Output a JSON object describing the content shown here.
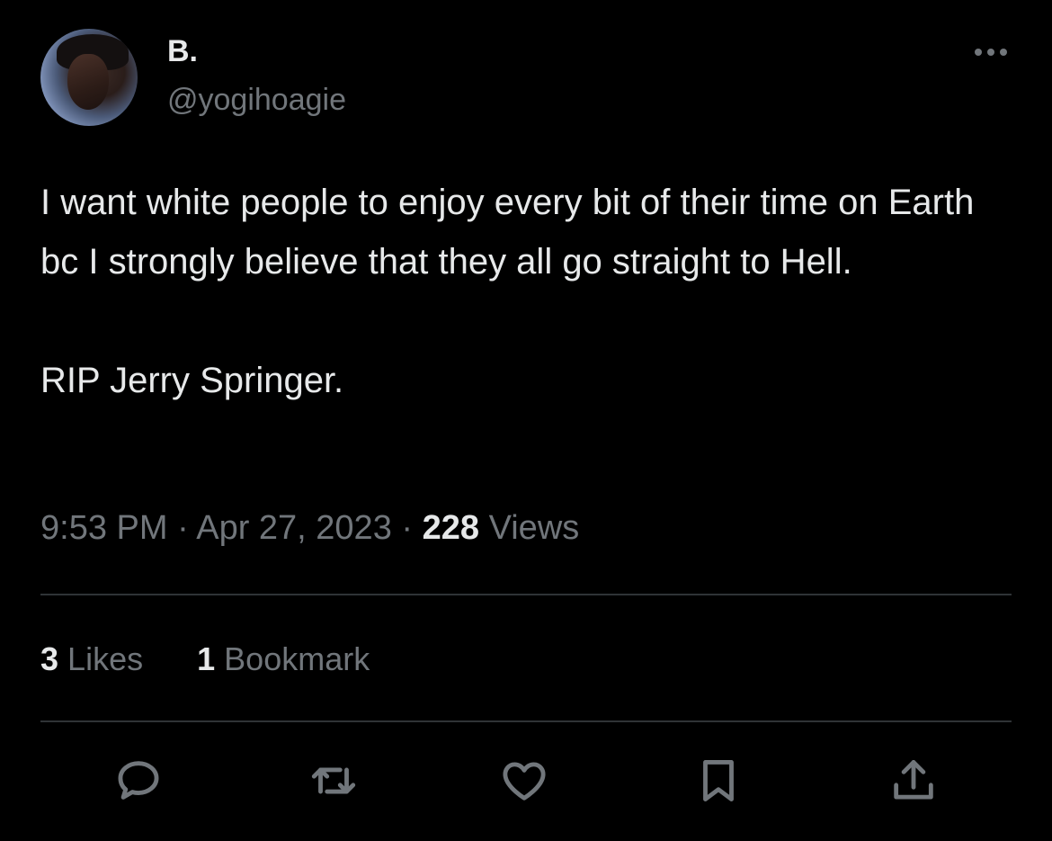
{
  "tweet": {
    "display_name": "B.",
    "handle": "@yogihoagie",
    "text": "I want white people to enjoy every bit of their time on Earth bc I strongly believe that they all go straight to Hell.\n\nRIP Jerry Springer.",
    "time": "9:53 PM",
    "date": "Apr 27, 2023",
    "separator": "·",
    "views_count": "228",
    "views_label": "Views",
    "likes_count": "3",
    "likes_label": "Likes",
    "bookmarks_count": "1",
    "bookmarks_label": "Bookmark"
  },
  "icons": {
    "more": "more-horizontal-icon",
    "reply": "reply-icon",
    "retweet": "retweet-icon",
    "like": "heart-icon",
    "bookmark": "bookmark-icon",
    "share": "share-icon"
  },
  "colors": {
    "background": "#000000",
    "primary_text": "#e7e9ea",
    "secondary_text": "#71767b",
    "divider": "#2f3336"
  }
}
